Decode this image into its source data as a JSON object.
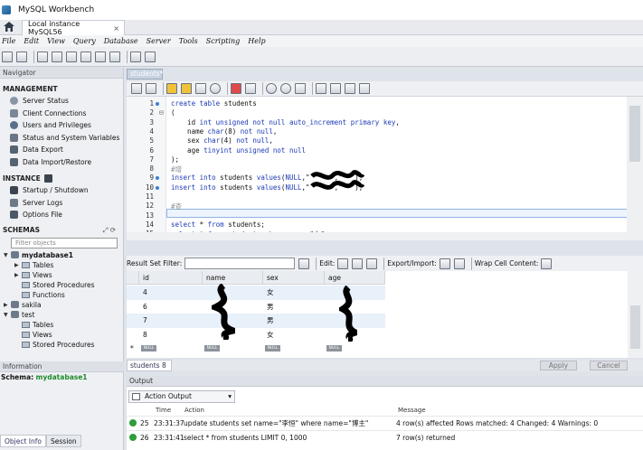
{
  "window": {
    "title": "MySQL Workbench"
  },
  "connection_tab": {
    "label": "Local instance MySQL56",
    "close": "×"
  },
  "menu": [
    "File",
    "Edit",
    "View",
    "Query",
    "Database",
    "Server",
    "Tools",
    "Scripting",
    "Help"
  ],
  "navigator": {
    "header": "Navigator",
    "management_title": "MANAGEMENT",
    "management": [
      "Server Status",
      "Client Connections",
      "Users and Privileges",
      "Status and System Variables",
      "Data Export",
      "Data Import/Restore"
    ],
    "instance_title": "INSTANCE",
    "instance": [
      "Startup / Shutdown",
      "Server Logs",
      "Options File"
    ],
    "schemas_title": "SCHEMAS",
    "filter_placeholder": "Filter objects",
    "tree": [
      {
        "label": "mydatabase1",
        "level": 0,
        "bold": true,
        "arrow": "▼",
        "kind": "db"
      },
      {
        "label": "Tables",
        "level": 1,
        "arrow": "▶",
        "kind": "folder"
      },
      {
        "label": "Views",
        "level": 1,
        "arrow": "▶",
        "kind": "folder"
      },
      {
        "label": "Stored Procedures",
        "level": 1,
        "arrow": "",
        "kind": "folder"
      },
      {
        "label": "Functions",
        "level": 1,
        "arrow": "",
        "kind": "folder"
      },
      {
        "label": "sakila",
        "level": 0,
        "arrow": "▶",
        "kind": "db"
      },
      {
        "label": "test",
        "level": 0,
        "arrow": "▼",
        "kind": "db"
      },
      {
        "label": "Tables",
        "level": 1,
        "arrow": "",
        "kind": "folder"
      },
      {
        "label": "Views",
        "level": 1,
        "arrow": "",
        "kind": "folder"
      },
      {
        "label": "Stored Procedures",
        "level": 1,
        "arrow": "",
        "kind": "folder"
      }
    ],
    "info_header": "Information",
    "schema_label": "Schema:",
    "schema_value": "mydatabase1",
    "bottom_tabs": [
      "Object Info",
      "Session"
    ]
  },
  "editor": {
    "tab": "students*",
    "lines": [
      {
        "n": "1",
        "dot": true,
        "text": "create table students"
      },
      {
        "n": "2",
        "dot": false,
        "text": "("
      },
      {
        "n": "3",
        "dot": false,
        "text": "    id int unsigned not null auto_increment primary key,"
      },
      {
        "n": "4",
        "dot": false,
        "text": "    name char(8) not null,"
      },
      {
        "n": "5",
        "dot": false,
        "text": "    sex char(4) not null,"
      },
      {
        "n": "6",
        "dot": false,
        "text": "    age tinyint unsigned not null"
      },
      {
        "n": "7",
        "dot": false,
        "text": ");"
      },
      {
        "n": "8",
        "dot": false,
        "text": "#增"
      },
      {
        "n": "9",
        "dot": true,
        "text": "insert into students values(NULL,\"     \",\"  \");"
      },
      {
        "n": "10",
        "dot": true,
        "text": "insert into students values(NULL,\"     \",\"  \");"
      },
      {
        "n": "11",
        "dot": false,
        "text": ""
      },
      {
        "n": "12",
        "dot": false,
        "text": "#查"
      },
      {
        "n": "13",
        "dot": false,
        "text": ""
      },
      {
        "n": "14",
        "dot": false,
        "text": "select * from students;"
      },
      {
        "n": "15",
        "dot": true,
        "text": "select * from students where sex =\"女\";"
      }
    ]
  },
  "result": {
    "filter_label": "Result Set Filter:",
    "edit_label": "Edit:",
    "export_label": "Export/Import:",
    "wrap_label": "Wrap Cell Content:",
    "columns": [
      "id",
      "name",
      "sex",
      "age"
    ],
    "rows": [
      {
        "id": "4",
        "name": "",
        "sex": "女",
        "age": ""
      },
      {
        "id": "6",
        "name": "",
        "sex": "男",
        "age": ""
      },
      {
        "id": "7",
        "name": "",
        "sex": "男",
        "age": ""
      },
      {
        "id": "8",
        "name": "",
        "sex": "女",
        "age": ""
      }
    ],
    "null_label": "NULL",
    "new_row_marker": "*",
    "tab": "students 8",
    "apply": "Apply",
    "cancel": "Cancel"
  },
  "output": {
    "header": "Output",
    "selector": "Action Output",
    "columns": [
      "Time",
      "Action",
      "Message"
    ],
    "rows": [
      {
        "num": "25",
        "time": "23:31:37",
        "action": "update students set name=\"李恒\" where name=\"博主\"",
        "message": "4 row(s) affected Rows matched: 4  Changed: 4  Warnings: 0"
      },
      {
        "num": "26",
        "time": "23:31:41",
        "action": "select * from students LIMIT 0, 1000",
        "message": "7 row(s) returned"
      }
    ]
  }
}
